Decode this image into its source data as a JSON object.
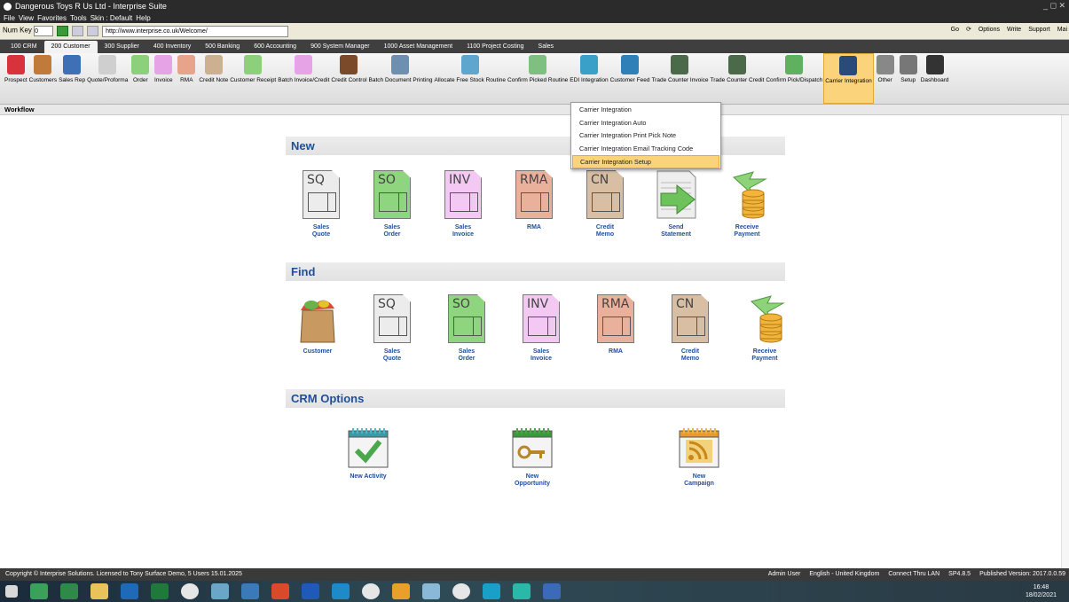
{
  "window": {
    "title": "Dangerous Toys R Us Ltd - Interprise Suite",
    "controls": "_ ◻ ✕"
  },
  "menu": {
    "items": [
      "File",
      "View",
      "Favorites",
      "Tools",
      "Skin : Default",
      "Help"
    ]
  },
  "address": {
    "numkey_label": "Num Key",
    "numkey_value": "0",
    "url": "http://www.interprise.co.uk/Welcome/",
    "right_go": "Go",
    "right_options": "Options",
    "right_write": "Write",
    "right_support": "Support",
    "right_mail": "Mai"
  },
  "tabs": [
    {
      "label": "100 CRM"
    },
    {
      "label": "200 Customer"
    },
    {
      "label": "300 Supplier"
    },
    {
      "label": "400 Inventory"
    },
    {
      "label": "500 Banking"
    },
    {
      "label": "600 Accounting"
    },
    {
      "label": "900 System Manager"
    },
    {
      "label": "1000 Asset Management"
    },
    {
      "label": "1100 Project Costing"
    },
    {
      "label": "Sales"
    }
  ],
  "ribbon": [
    {
      "label": "Prospect",
      "icon": "target-icon",
      "color": "#d8323c"
    },
    {
      "label": "Customers",
      "icon": "people-icon",
      "color": "#c07a3a"
    },
    {
      "label": "Sales Rep",
      "icon": "person-icon",
      "color": "#3f6fb5"
    },
    {
      "label": "Quote/Proforma",
      "icon": "quote-doc-icon",
      "color": "#cfcfcf"
    },
    {
      "label": "Order",
      "icon": "order-doc-icon",
      "color": "#8cd07c"
    },
    {
      "label": "Invoice",
      "icon": "invoice-doc-icon",
      "color": "#e6a3e6"
    },
    {
      "label": "RMA",
      "icon": "rma-doc-icon",
      "color": "#e7a48a"
    },
    {
      "label": "Credit Note",
      "icon": "credit-doc-icon",
      "color": "#cdb08f"
    },
    {
      "label": "Customer Receipt",
      "icon": "receipt-doc-icon",
      "color": "#8cd07c"
    },
    {
      "label": "Batch Invoice/Credit",
      "icon": "batch-doc-icon",
      "color": "#e6a3e6"
    },
    {
      "label": "Credit Control",
      "icon": "credit-control-icon",
      "color": "#7a4a2a"
    },
    {
      "label": "Batch Document Printing",
      "icon": "printer-icon",
      "color": "#6f8fb0"
    },
    {
      "label": "Allocate Free Stock Routine",
      "icon": "grid-icon",
      "color": "#5fa6cf"
    },
    {
      "label": "Confirm Picked Routine",
      "icon": "checklist-icon",
      "color": "#7fbf7f"
    },
    {
      "label": "EDI Integration",
      "icon": "edi-icon",
      "color": "#3aa0c8"
    },
    {
      "label": "Customer Feed",
      "icon": "feed-icon",
      "color": "#2f7fb8"
    },
    {
      "label": "Trade Counter Invoice",
      "icon": "register-icon",
      "color": "#4a6a4a"
    },
    {
      "label": "Trade Counter Credit",
      "icon": "register-credit-icon",
      "color": "#4a6a4a"
    },
    {
      "label": "Confirm Pick/Dispatch",
      "icon": "dispatch-icon",
      "color": "#5fb05f"
    },
    {
      "label": "Carrier Integration",
      "icon": "carrier-icon",
      "color": "#2a4a7a"
    },
    {
      "label": "Other",
      "icon": "dots-icon",
      "color": "#888888"
    },
    {
      "label": "Setup",
      "icon": "gear-icon",
      "color": "#777777"
    },
    {
      "label": "Dashboard",
      "icon": "dashboard-icon",
      "color": "#333333"
    }
  ],
  "workflow_label": "Workflow",
  "dropdown": [
    "Carrier Integration",
    "Carrier Integration Auto",
    "Carrier Integration Print Pick Note",
    "Carrier Integration Email Tracking Code",
    "Carrier Integration Setup"
  ],
  "sections": {
    "new": "New",
    "find": "Find",
    "crm": "CRM Options"
  },
  "new_tiles": [
    {
      "code": "SQ",
      "label1": "Sales",
      "label2": "Quote"
    },
    {
      "code": "SO",
      "label1": "Sales",
      "label2": "Order"
    },
    {
      "code": "INV",
      "label1": "Sales",
      "label2": "Invoice"
    },
    {
      "code": "RMA",
      "label1": "RMA",
      "label2": ""
    },
    {
      "code": "CN",
      "label1": "Credit",
      "label2": "Memo"
    },
    {
      "code": "",
      "label1": "Send",
      "label2": "Statement"
    },
    {
      "code": "",
      "label1": "Receive",
      "label2": "Payment"
    }
  ],
  "find_tiles": [
    {
      "code": "",
      "label1": "Customer",
      "label2": ""
    },
    {
      "code": "SQ",
      "label1": "Sales",
      "label2": "Quote"
    },
    {
      "code": "SO",
      "label1": "Sales",
      "label2": "Order"
    },
    {
      "code": "INV",
      "label1": "Sales",
      "label2": "Invoice"
    },
    {
      "code": "RMA",
      "label1": "RMA",
      "label2": ""
    },
    {
      "code": "CN",
      "label1": "Credit",
      "label2": "Memo"
    },
    {
      "code": "",
      "label1": "Receive",
      "label2": "Payment"
    }
  ],
  "crm_tiles": [
    {
      "label1": "New Activity",
      "label2": ""
    },
    {
      "label1": "New",
      "label2": "Opportunity"
    },
    {
      "label1": "New",
      "label2": "Campaign"
    }
  ],
  "status": {
    "left": "Copyright © Interprise Solutions. Licensed to Tony Surface Demo, 5 Users 15.01.2025",
    "user": "Admin User",
    "lang": "English - United Kingdom",
    "conn": "Connect Thru LAN",
    "sp": "SP4.8.5",
    "version": "Published Version: 2017.0.0.59"
  },
  "clock": {
    "time": "16:48",
    "date": "18/02/2021"
  }
}
